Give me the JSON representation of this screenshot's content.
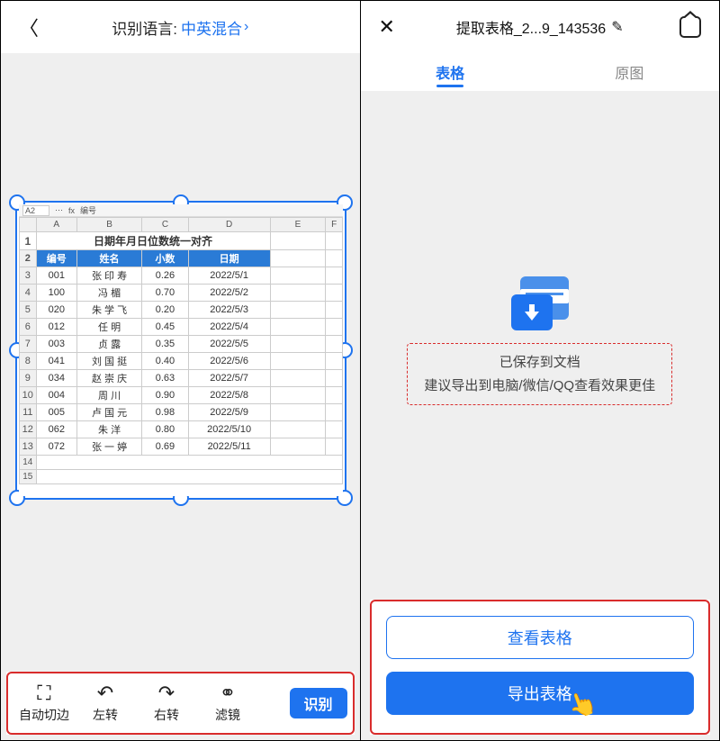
{
  "left": {
    "lang_label": "识别语言:",
    "lang_value": "中英混合",
    "formula_cell": "A2",
    "formula_content": "编号",
    "columns": [
      "A",
      "B",
      "C",
      "D",
      "E",
      "F"
    ],
    "table_title": "日期年月日位数统一对齐",
    "headers": [
      "编号",
      "姓名",
      "小数",
      "日期"
    ],
    "rows": [
      [
        "001",
        "张 印 寿",
        "0.26",
        "2022/5/1"
      ],
      [
        "100",
        "冯    楣",
        "0.70",
        "2022/5/2"
      ],
      [
        "020",
        "朱 学 飞",
        "0.20",
        "2022/5/3"
      ],
      [
        "012",
        "任    明",
        "0.45",
        "2022/5/4"
      ],
      [
        "003",
        "贞    露",
        "0.35",
        "2022/5/5"
      ],
      [
        "041",
        "刘 国 挺",
        "0.40",
        "2022/5/6"
      ],
      [
        "034",
        "赵 崇 庆",
        "0.63",
        "2022/5/7"
      ],
      [
        "004",
        "周    川",
        "0.90",
        "2022/5/8"
      ],
      [
        "005",
        "卢 国 元",
        "0.98",
        "2022/5/9"
      ],
      [
        "062",
        "朱    洋",
        "0.80",
        "2022/5/10"
      ],
      [
        "072",
        "张 一 婷",
        "0.69",
        "2022/5/11"
      ]
    ],
    "tools": {
      "auto_crop": "自动切边",
      "rotate_left": "左转",
      "rotate_right": "右转",
      "filter": "滤镜",
      "recognize": "识别"
    }
  },
  "right": {
    "title": "提取表格_2...9_143536",
    "tabs": {
      "table": "表格",
      "original": "原图"
    },
    "saved_line1": "已保存到文档",
    "saved_line2": "建议导出到电脑/微信/QQ查看效果更佳",
    "view_btn": "查看表格",
    "export_btn": "导出表格"
  }
}
